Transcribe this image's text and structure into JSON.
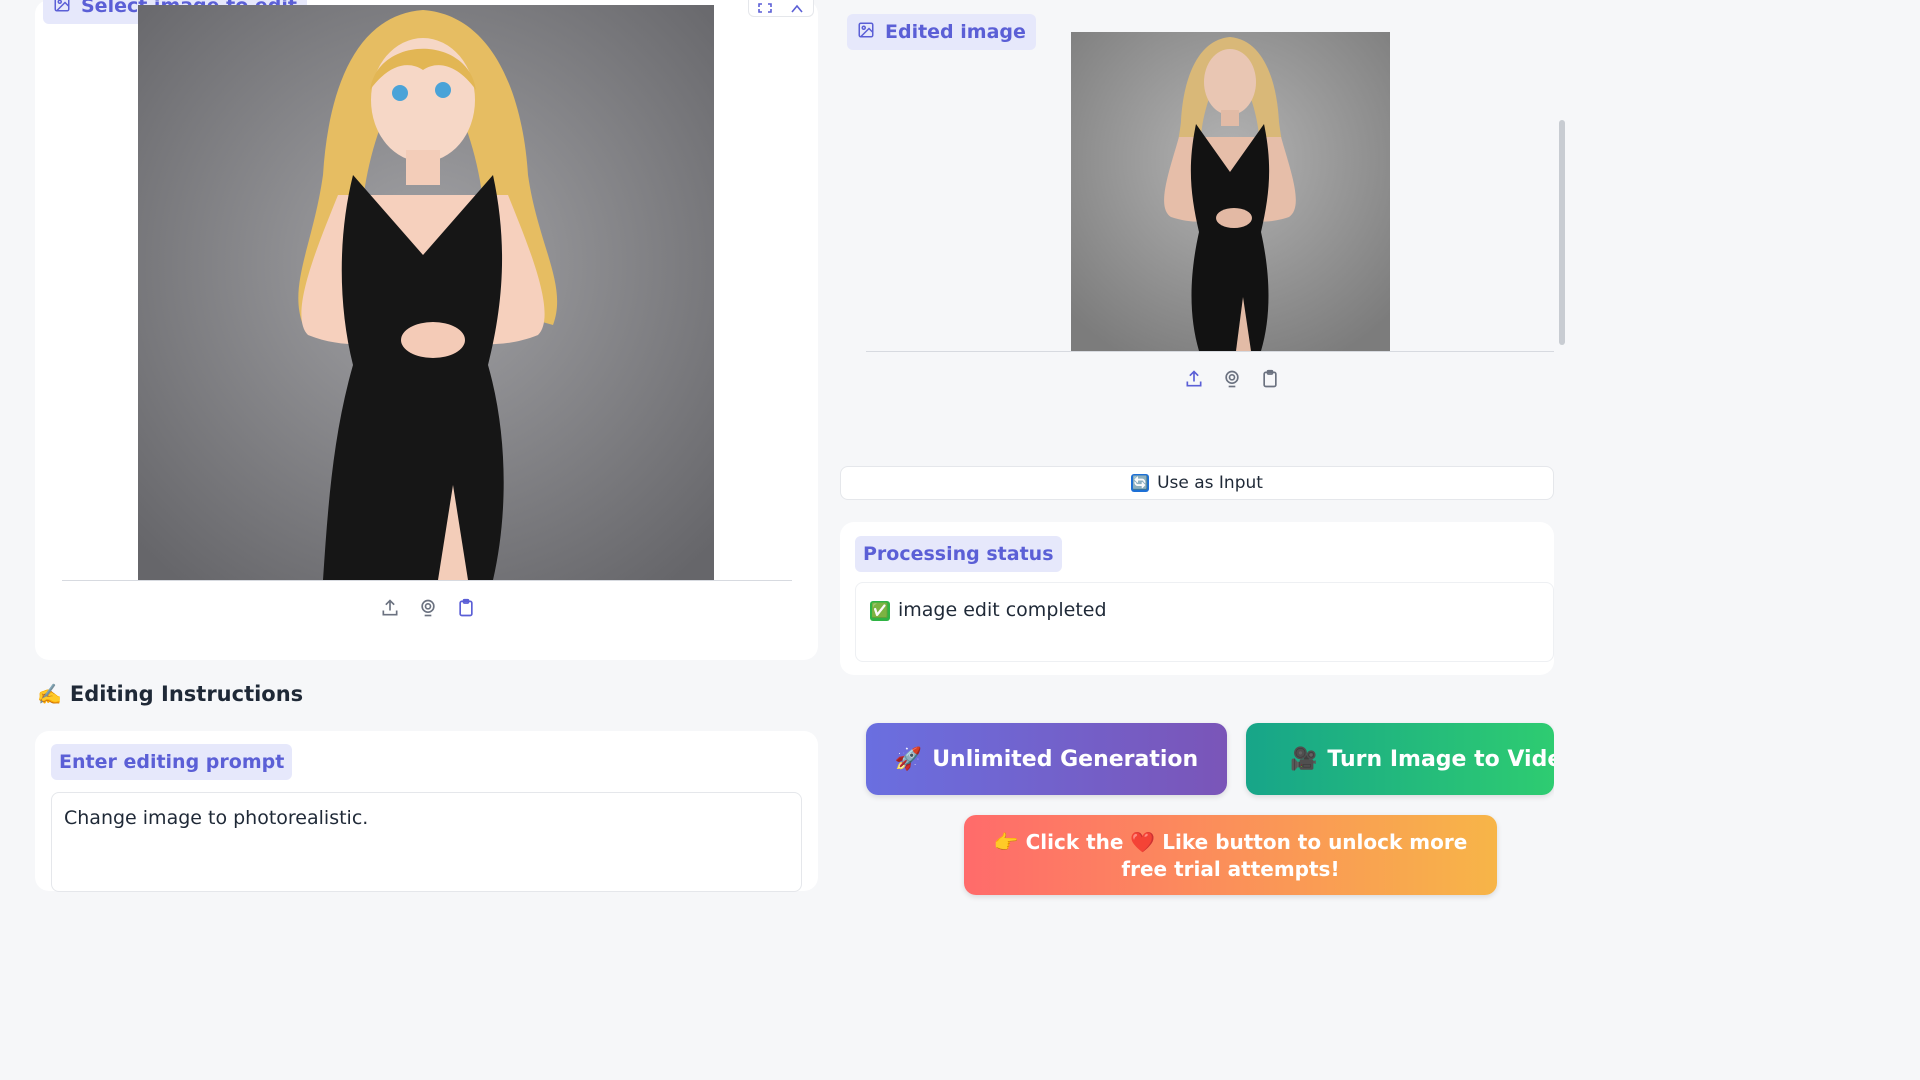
{
  "input_panel": {
    "label": "Select image to edit",
    "label_icon": "image-icon",
    "tools": [
      "upload-icon",
      "webcam-icon",
      "clipboard-icon"
    ],
    "corner_buttons": [
      "fullscreen-icon",
      "close-icon"
    ]
  },
  "output_panel": {
    "label": "Edited image",
    "label_icon": "image-icon",
    "tools": [
      "upload-icon",
      "webcam-icon",
      "clipboard-icon"
    ],
    "use_as_input_label": "Use as Input",
    "use_as_input_icon": "🔄"
  },
  "status": {
    "label": "Processing status",
    "icon": "✅",
    "text": "image edit completed"
  },
  "instructions": {
    "title_icon": "✍️",
    "title": "Editing Instructions",
    "prompt_label": "Enter editing prompt",
    "prompt_value": "Change image to photorealistic."
  },
  "actions": {
    "unlimited_icon": "🚀",
    "unlimited_label": "Unlimited Generation",
    "video_icon": "🎥",
    "video_label": "Turn Image to Video",
    "like_prefix_icon": "👉",
    "like_text_a": "Click the",
    "like_heart": "❤️",
    "like_text_b": "Like button to unlock more free trial attempts!"
  },
  "colors": {
    "accent": "#5b5fd6",
    "chip_bg": "#e6e8fb",
    "purple_start": "#6a6fe0",
    "green_end": "#2ecc71",
    "orange_end": "#f7b548"
  }
}
